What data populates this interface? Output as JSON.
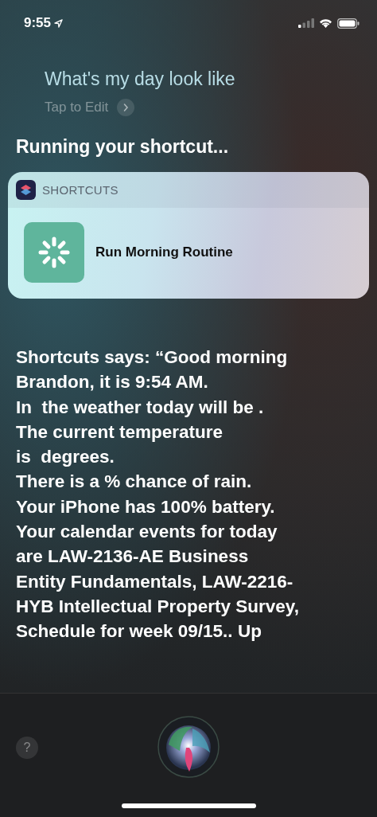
{
  "status_bar": {
    "time": "9:55"
  },
  "query": {
    "text": "What's my day look like",
    "edit_label": "Tap to Edit"
  },
  "heading": "Running your shortcut...",
  "card": {
    "app_name": "SHORTCUTS",
    "shortcut_name": "Run Morning Routine"
  },
  "response": "Shortcuts says: “Good morning\nBrandon, it is 9:54 AM.\nIn  the weather today will be .\nThe current temperature\nis  degrees.\nThere is a % chance of rain.\nYour iPhone has 100% battery.\nYour calendar events for today\nare LAW-2136-AE Business\nEntity Fundamentals, LAW-2216-\nHYB Intellectual Property Survey,\nSchedule for week 09/15.. Up",
  "help_button": "?"
}
